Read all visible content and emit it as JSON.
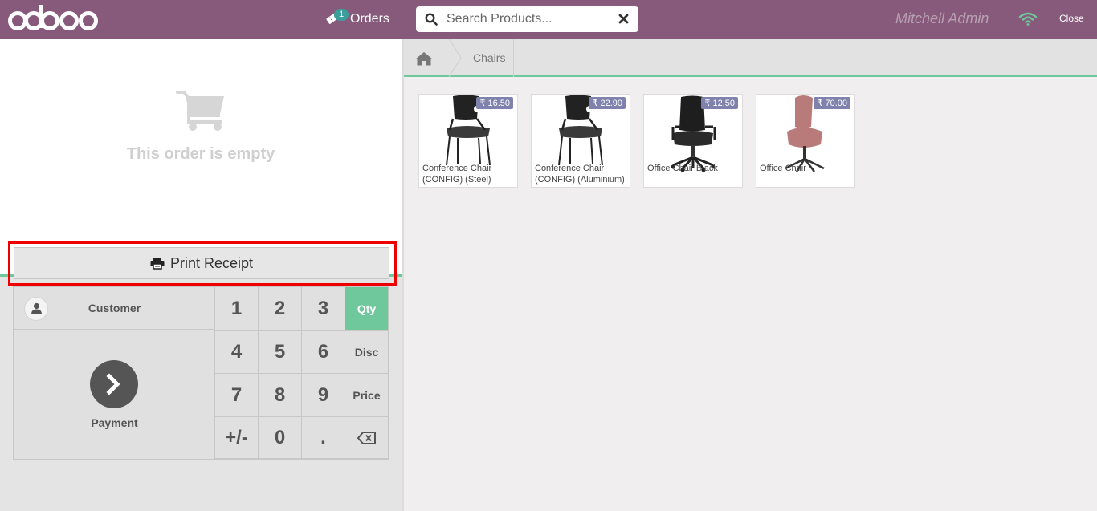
{
  "header": {
    "logo_text": "odoo",
    "orders_label": "Orders",
    "orders_count": "1",
    "search_placeholder": "Search Products...",
    "user_name": "Mitchell Admin",
    "close_label": "Close"
  },
  "order": {
    "empty_message": "This order is empty",
    "print_label": "Print Receipt"
  },
  "numpad": {
    "customer_label": "Customer",
    "payment_label": "Payment",
    "keys": [
      "1",
      "2",
      "3",
      "4",
      "5",
      "6",
      "7",
      "8",
      "9",
      "+/-",
      "0",
      "."
    ],
    "modes": [
      "Qty",
      "Disc",
      "Price"
    ],
    "active_mode": "Qty"
  },
  "breadcrumb": {
    "category": "Chairs"
  },
  "products": [
    {
      "name": "Conference Chair (CONFIG) (Steel)",
      "price": "₹ 16.50"
    },
    {
      "name": "Conference Chair (CONFIG) (Aluminium)",
      "price": "₹ 22.90"
    },
    {
      "name": "Office Chair Black",
      "price": "₹ 12.50"
    },
    {
      "name": "Office Chair",
      "price": "₹ 70.00"
    }
  ],
  "colors": {
    "brand": "#875a7b",
    "accent": "#6ec89b",
    "price_tag": "#7f82ac",
    "highlight": "#ee0000"
  }
}
